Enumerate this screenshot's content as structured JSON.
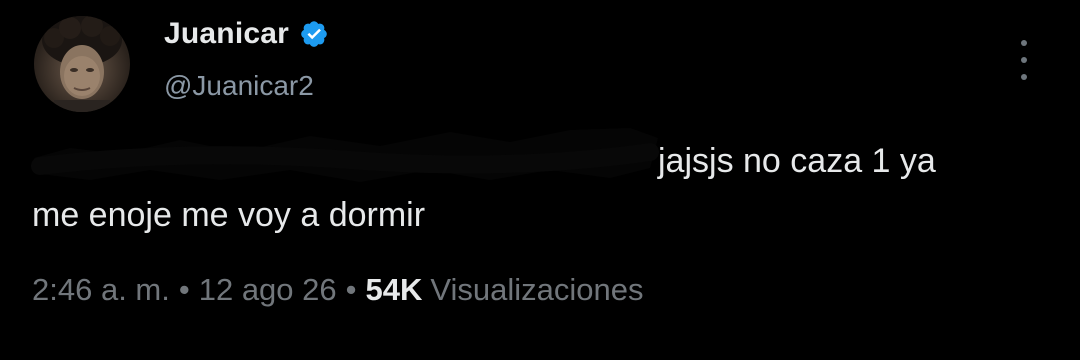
{
  "author": {
    "display_name": "Juanicar",
    "handle": "@Juanicar2",
    "verified_icon": "verified-badge-icon",
    "avatar": "profile-photo"
  },
  "tweet": {
    "text_line1": "jajsjs no caza 1 ya",
    "text_line2": "me enoje me voy a dormir",
    "redacted": true
  },
  "meta": {
    "time": "2:46 a. m.",
    "separator": "•",
    "date": "12 ago 26",
    "views_count": "54K",
    "views_label": "Visualizaciones"
  },
  "colors": {
    "background": "#000000",
    "text_primary": "#e7e9ea",
    "text_secondary": "#71767b",
    "verified_blue": "#1d9bf0"
  },
  "icons": {
    "more": "more-options-icon"
  }
}
